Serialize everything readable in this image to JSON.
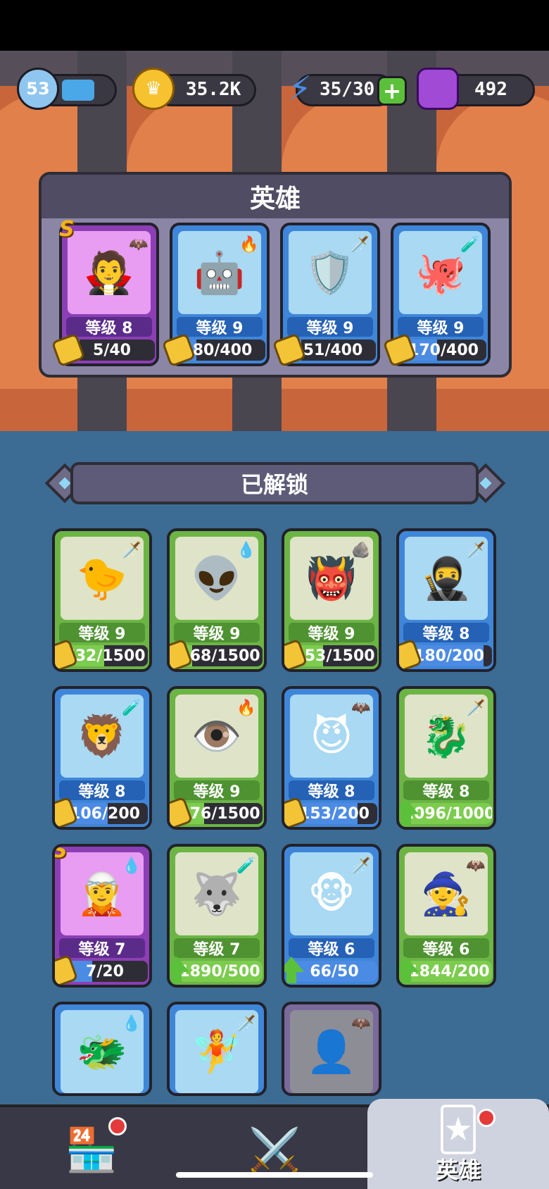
{
  "top": {
    "player_level": "53",
    "gold": "35.2K",
    "energy": "35/30",
    "gems": "492"
  },
  "team": {
    "title": "英雄",
    "cards": [
      {
        "style": "purple",
        "rare": "S",
        "badge": "bat",
        "emoji": "🧛",
        "level": "等级 8",
        "progress": "5/40",
        "fill": 0.125,
        "marker": "puzzle"
      },
      {
        "style": "blue",
        "rare": "",
        "badge": "fire",
        "emoji": "🤖",
        "level": "等级 9",
        "progress": "80/400",
        "fill": 0.2,
        "marker": "puzzle"
      },
      {
        "style": "blue",
        "rare": "",
        "badge": "sword",
        "emoji": "🛡️",
        "level": "等级 9",
        "progress": "51/400",
        "fill": 0.13,
        "marker": "puzzle"
      },
      {
        "style": "blue",
        "rare": "",
        "badge": "potion",
        "emoji": "🐙",
        "level": "等级 9",
        "progress": "170/400",
        "fill": 0.43,
        "marker": "puzzle"
      }
    ]
  },
  "unlocked": {
    "title": "已解锁",
    "cards": [
      {
        "style": "green",
        "rare": "",
        "badge": "sword",
        "emoji": "🐤",
        "level": "等级 9",
        "progress": "732/1500",
        "fill": 0.49,
        "marker": "puzzle"
      },
      {
        "style": "green",
        "rare": "",
        "badge": "water",
        "emoji": "👽",
        "level": "等级 9",
        "progress": "268/1500",
        "fill": 0.18,
        "marker": "puzzle"
      },
      {
        "style": "green",
        "rare": "",
        "badge": "rock",
        "emoji": "👹",
        "level": "等级 9",
        "progress": "553/1500",
        "fill": 0.37,
        "marker": "puzzle"
      },
      {
        "style": "blue",
        "rare": "",
        "badge": "sword",
        "emoji": "🥷",
        "level": "等级 8",
        "progress": "180/200",
        "fill": 0.9,
        "marker": "puzzle"
      },
      {
        "style": "blue",
        "rare": "",
        "badge": "potion",
        "emoji": "🦁",
        "level": "等级 8",
        "progress": "106/200",
        "fill": 0.53,
        "marker": "puzzle"
      },
      {
        "style": "green",
        "rare": "",
        "badge": "fire",
        "emoji": "👁️",
        "level": "等级 9",
        "progress": "476/1500",
        "fill": 0.32,
        "marker": "puzzle"
      },
      {
        "style": "blue",
        "rare": "",
        "badge": "bat",
        "emoji": "😈",
        "level": "等级 8",
        "progress": "153/200",
        "fill": 0.77,
        "marker": "puzzle"
      },
      {
        "style": "green",
        "rare": "",
        "badge": "sword",
        "emoji": "🐉",
        "level": "等级 8",
        "progress": "1096/1000",
        "fill": 1.0,
        "marker": "up"
      },
      {
        "style": "purple",
        "rare": "S",
        "badge": "water",
        "emoji": "🧝",
        "level": "等级 7",
        "progress": "7/20",
        "fill": 0.35,
        "marker": "puzzle"
      },
      {
        "style": "green",
        "rare": "",
        "badge": "potion",
        "emoji": "🐺",
        "level": "等级 7",
        "progress": "1890/500",
        "fill": 1.0,
        "marker": "up"
      },
      {
        "style": "blue",
        "rare": "",
        "badge": "sword",
        "emoji": "🐵",
        "level": "等级 6",
        "progress": "66/50",
        "fill": 1.0,
        "marker": "up"
      },
      {
        "style": "green",
        "rare": "",
        "badge": "bat",
        "emoji": "🧙",
        "level": "等级 6",
        "progress": "1844/200",
        "fill": 1.0,
        "marker": "up"
      },
      {
        "style": "blue",
        "rare": "",
        "badge": "water",
        "emoji": "🐲",
        "level": "",
        "progress": "",
        "fill": 0,
        "marker": "none"
      },
      {
        "style": "blue",
        "rare": "",
        "badge": "sword",
        "emoji": "🧚",
        "level": "",
        "progress": "",
        "fill": 0,
        "marker": "none"
      },
      {
        "style": "locked",
        "rare": "",
        "badge": "bat",
        "emoji": "👤",
        "level": "",
        "progress": "",
        "fill": 0,
        "marker": "none"
      }
    ]
  },
  "nav": {
    "shop_icon": "shop-icon",
    "battle_icon": "crossed-swords-icon",
    "heroes_label": "英雄"
  }
}
